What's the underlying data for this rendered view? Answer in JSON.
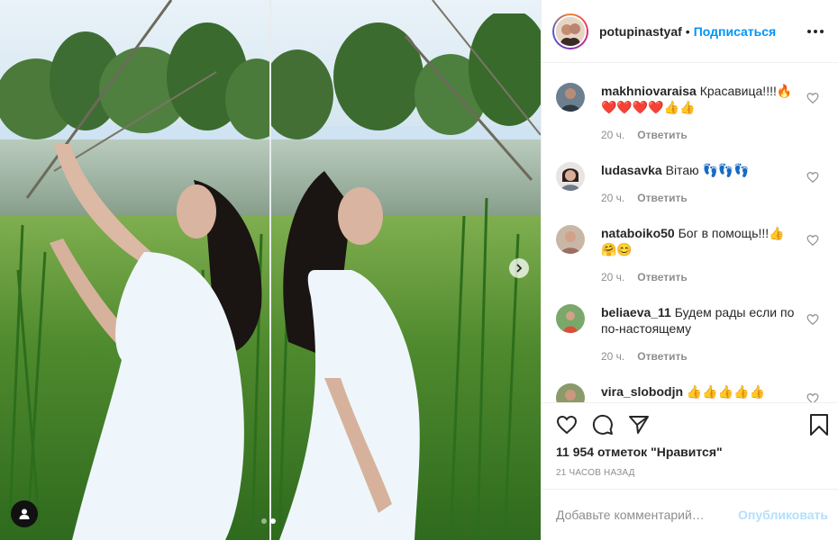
{
  "post": {
    "username": "potupinastyaf",
    "separator": "•",
    "follow_label": "Подписаться"
  },
  "comments": [
    {
      "username": "makhniovaraisa",
      "text": "Красавица!!!!🔥",
      "text2": "❤️❤️❤️❤️👍👍",
      "time": "20 ч.",
      "reply": "Ответить"
    },
    {
      "username": "ludasavka",
      "text": "Вітаю 👣👣👣",
      "time": "20 ч.",
      "reply": "Ответить"
    },
    {
      "username": "nataboiko50",
      "text": "Бог в помощь!!!👍",
      "text2": "🤗😊",
      "time": "20 ч.",
      "reply": "Ответить"
    },
    {
      "username": "beliaeva_11",
      "text": "Будем рады если по",
      "text2": "по-настоящему",
      "time": "20 ч.",
      "reply": "Ответить"
    },
    {
      "username": "vira_slobodjn",
      "text": "👍👍👍👍👍"
    }
  ],
  "likes": {
    "text": "11 954 отметок \"Нравится\""
  },
  "timestamp": "21 ЧАСОВ НАЗАД",
  "add_comment": {
    "placeholder": "Добавьте комментарий…",
    "publish_label": "Опубликовать"
  },
  "icons": {
    "like": "heart-icon",
    "comment": "comment-icon",
    "share": "paper-plane-icon",
    "save": "bookmark-icon",
    "next": "chevron-right-icon",
    "tags": "user-icon",
    "more": "more-dots-icon"
  },
  "colors": {
    "link": "#0095f6",
    "meta": "#8e8e8e",
    "text": "#262626",
    "publish_disabled": "#b2dffc"
  },
  "carousel": {
    "slide_count": 2,
    "active_slide": 2
  }
}
